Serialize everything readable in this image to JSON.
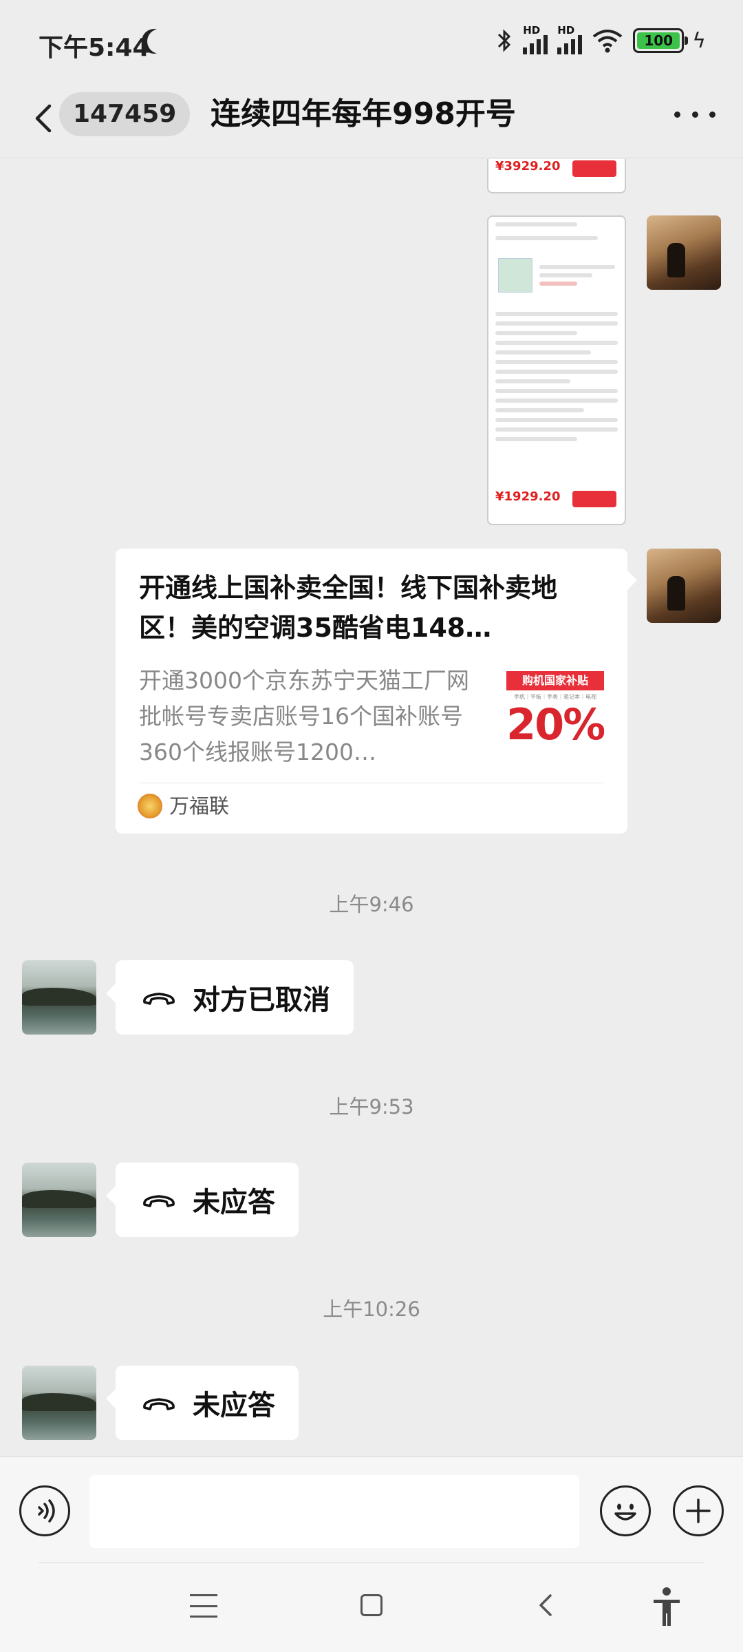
{
  "status_bar": {
    "time": "下午5:44",
    "network_label": "HD",
    "battery": "100"
  },
  "header": {
    "unread_count": "147459",
    "title": "连续四年每年998开号"
  },
  "messages": {
    "shot1_price": "¥3929.20",
    "shot2_price": "¥1929.20",
    "card": {
      "title": "开通线上国补卖全国！线下国补卖地区！美的空调35酷省电148…",
      "desc": "开通3000个京东苏宁天猫工厂网批帐号专卖店账号16个国补账号360个线报账号1200…",
      "thumb_band": "购机国家补贴",
      "thumb_sub": "手机｜平板｜手表｜笔记本｜电视",
      "thumb_percent": "20%",
      "source": "万福联"
    },
    "time1": "上午9:46",
    "call1": "对方已取消",
    "time2": "上午9:53",
    "call2": "未应答",
    "time3": "上午10:26",
    "call3": "未应答"
  },
  "input": {
    "placeholder": ""
  },
  "icons": {
    "back": "chevron-left-icon",
    "more": "more-dots-icon",
    "voice": "voice-icon",
    "emoji": "emoji-icon",
    "plus": "plus-icon",
    "phone": "phone-hangup-icon"
  },
  "colors": {
    "background": "#ededed",
    "bubble": "#ffffff",
    "accent_red": "#e8303a",
    "battery_green": "#3cc24a"
  }
}
